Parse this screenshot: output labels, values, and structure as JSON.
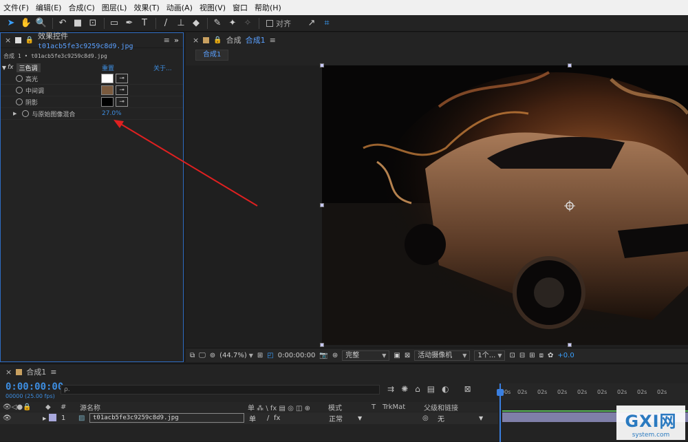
{
  "menu": [
    "文件(F)",
    "编辑(E)",
    "合成(C)",
    "图层(L)",
    "效果(T)",
    "动画(A)",
    "视图(V)",
    "窗口",
    "帮助(H)"
  ],
  "toolbar": {
    "snap_label": "对齐"
  },
  "effects_panel": {
    "tab_prefix": "效果控件",
    "tab_file": "t01acb5fe3c9259c8d9.jpg",
    "path": "合成 1 • t01acb5fe3c9259c8d9.jpg",
    "fx_label": "fx",
    "effect_name": "三色调",
    "reset": "重置",
    "about": "关于...",
    "props": [
      {
        "label": "高光",
        "color": "#ffffff"
      },
      {
        "label": "中间调",
        "color": "#7a5a3e"
      },
      {
        "label": "阴影",
        "color": "#000000"
      }
    ],
    "blend_label": "与原始图像混合",
    "blend_value": "27.0%"
  },
  "comp_panel": {
    "tab_prefix": "合成",
    "tab_name": "合成1",
    "sub_tab": "合成1",
    "zoom": "(44.7%)",
    "timecode": "0:00:00:00",
    "resolution": "完整",
    "camera": "活动摄像机",
    "views": "1个...",
    "exposure": "+0.0"
  },
  "timeline": {
    "tab": "合成1",
    "timecode": "0:00:00:00",
    "fps": "00000 (25.00 fps)",
    "search_placeholder": "ρ.",
    "ruler_ticks": [
      "00s",
      "02s",
      "02s",
      "02s",
      "02s",
      "02s",
      "02s",
      "02s",
      "02s"
    ],
    "col_source": "源名称",
    "col_mode": "模式",
    "col_t": "T",
    "col_trkmat": "TrkMat",
    "col_parent": "父级和链接",
    "col_switches": "单 ⁂ \\ fx ▤ ◎ ◫ ⊕",
    "layer": {
      "num": "1",
      "name": "t01acb5fe3c9259c8d9.jpg",
      "mode": "正常",
      "parent": "无"
    }
  },
  "watermark": {
    "logo": "GXI网",
    "site": "system.com"
  },
  "colors": {
    "accent": "#3d8de0",
    "arrow": "#e02020"
  }
}
